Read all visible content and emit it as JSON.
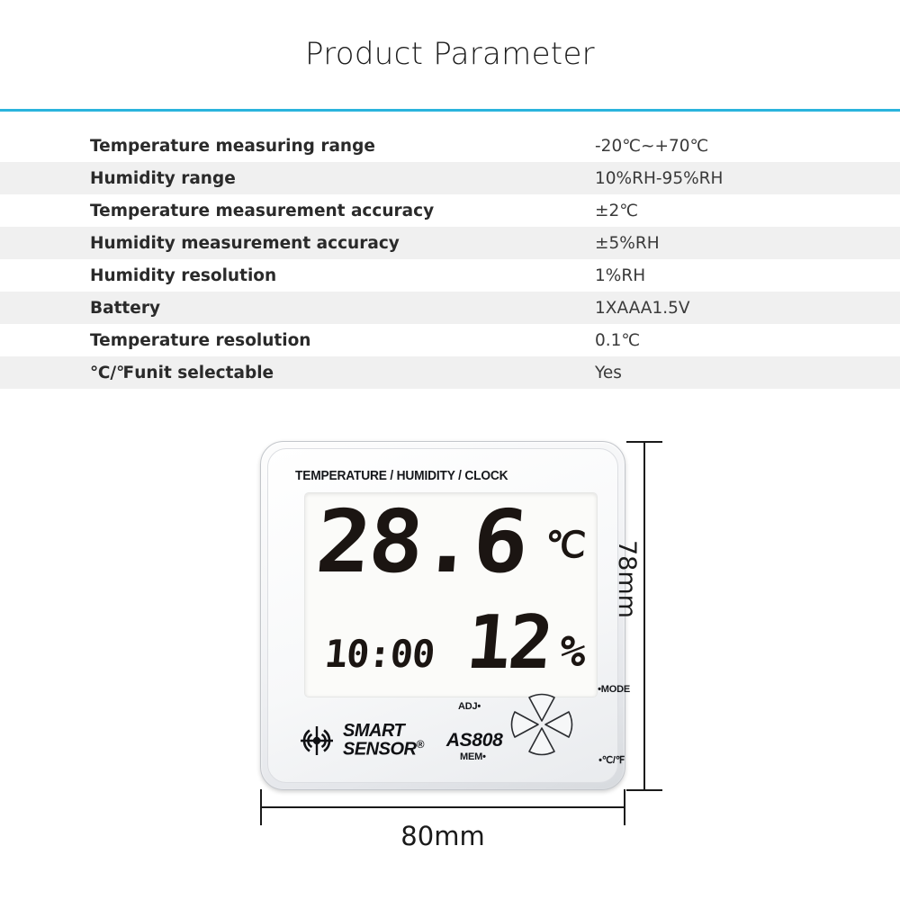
{
  "header": {
    "title": "Product Parameter",
    "divider_color": "#2bb4dd"
  },
  "spec_table": {
    "rows": [
      {
        "label": "Temperature measuring range",
        "value": "-20℃~+70℃"
      },
      {
        "label": "Humidity range",
        "value": "10%RH-95%RH"
      },
      {
        "label": "Temperature measurement accuracy",
        "value": "±2℃"
      },
      {
        "label": "Humidity measurement accuracy",
        "value": "±5%RH"
      },
      {
        "label": "Humidity resolution",
        "value": "1%RH"
      },
      {
        "label": "Battery",
        "value": "1XAAA1.5V"
      },
      {
        "label": "Temperature resolution",
        "value": "0.1℃"
      },
      {
        "label": "℃/℉unit selectable",
        "value": "Yes"
      }
    ]
  },
  "device": {
    "header_label": "TEMPERATURE / HUMIDITY / CLOCK",
    "lcd": {
      "temperature": "28.6",
      "temperature_unit": "℃",
      "clock": "10:00",
      "humidity": "12",
      "humidity_unit": "%"
    },
    "brand_line1": "SMART",
    "brand_line2": "SENSOR",
    "brand_registered": "®",
    "model": "AS808",
    "buttons": {
      "adj": "ADJ•",
      "mode": "•MODE",
      "mem": "MEM•",
      "unit": "•℃/℉"
    }
  },
  "dimensions": {
    "height_label": "78mm",
    "width_label": "80mm"
  }
}
